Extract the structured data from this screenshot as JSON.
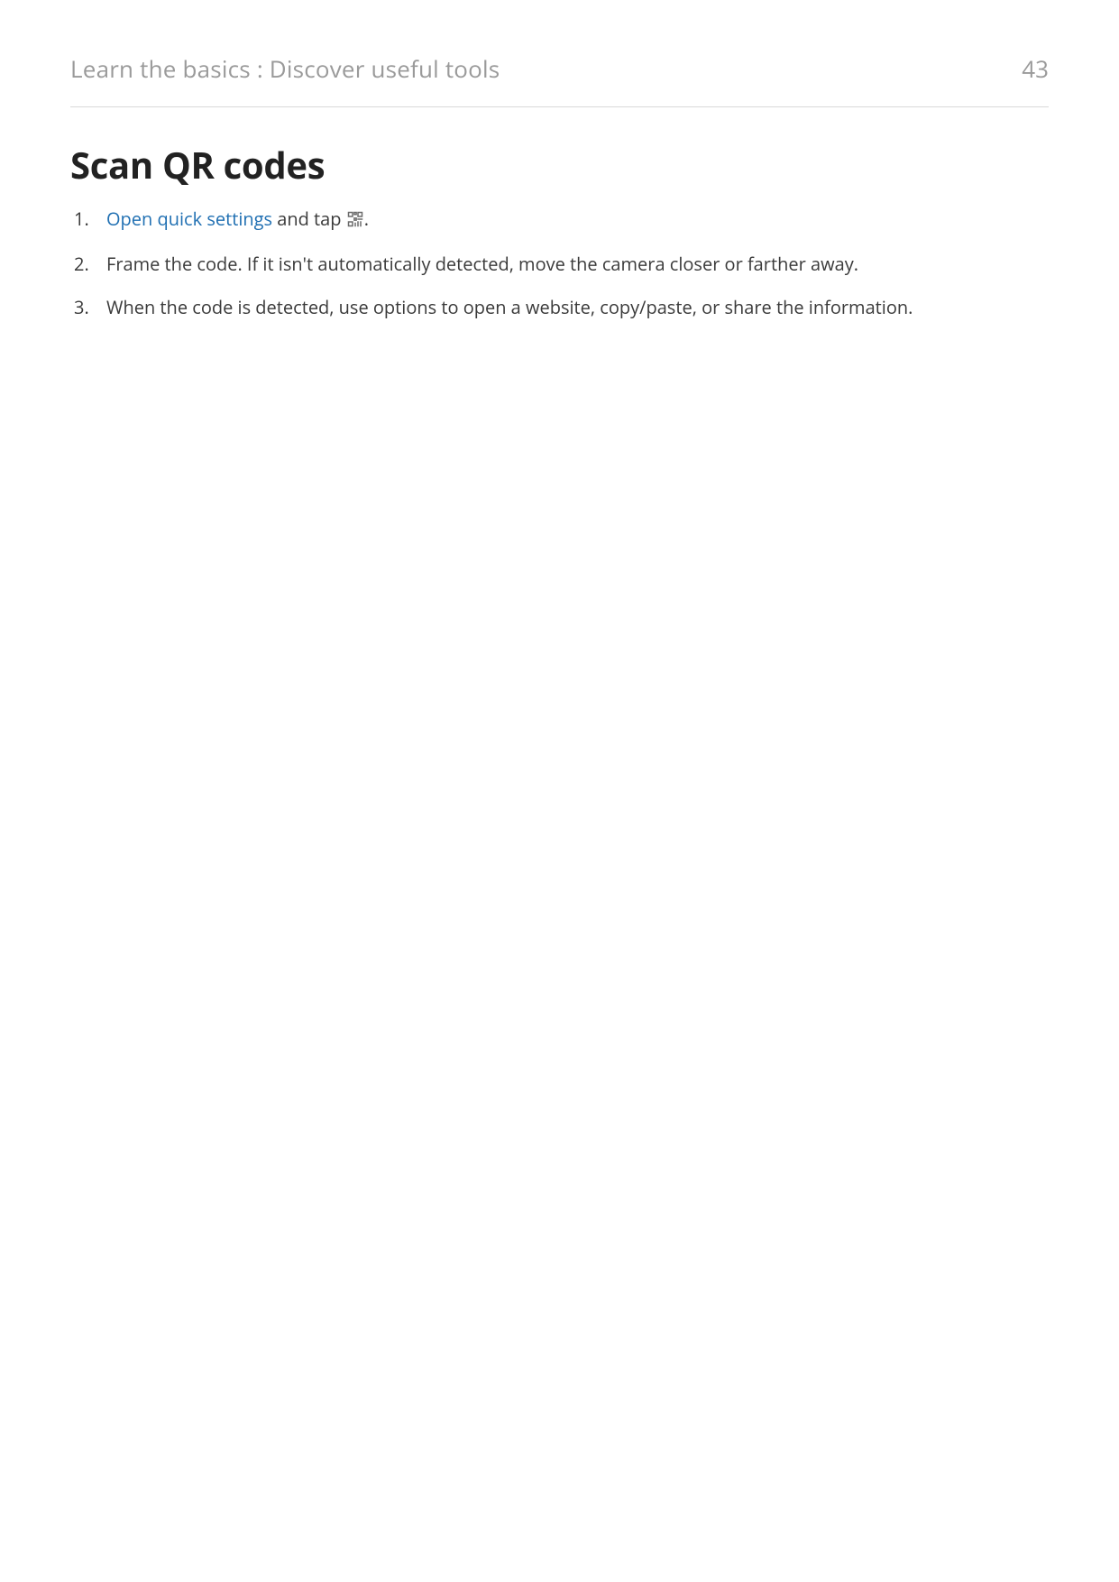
{
  "header": {
    "breadcrumb": "Learn the basics : Discover useful tools",
    "page_number": "43"
  },
  "heading": "Scan QR codes",
  "steps": {
    "s1_link": "Open quick settings",
    "s1_after_link": " and tap ",
    "s1_tail": ".",
    "s2": "Frame the code. If it isn't automatically detected, move the camera closer or farther away.",
    "s3": "When the code is detected, use options to open a website, copy/paste, or share the information."
  },
  "icons": {
    "qr": "qr-scan-icon"
  }
}
